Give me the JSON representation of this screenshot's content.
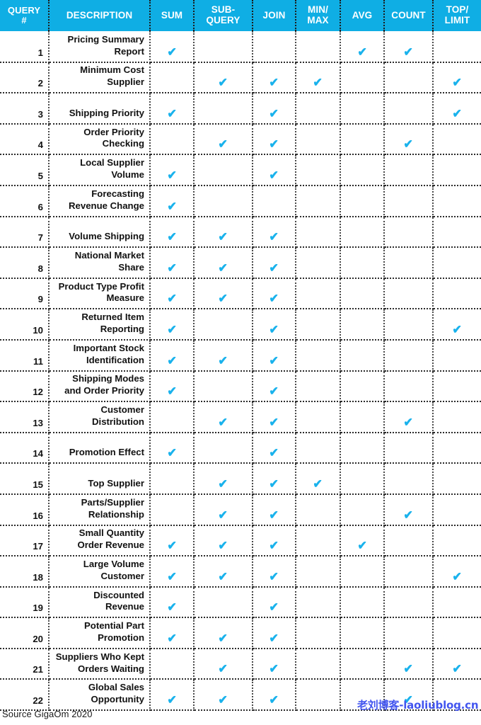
{
  "table": {
    "columns": [
      {
        "key": "query_no",
        "label": "QUERY\n#",
        "label_lines": [
          "QUERY",
          "#"
        ]
      },
      {
        "key": "description",
        "label": "DESCRIPTION",
        "label_lines": [
          "DESCRIPTION"
        ]
      },
      {
        "key": "sum",
        "label": "SUM",
        "label_lines": [
          "SUM"
        ]
      },
      {
        "key": "subquery",
        "label": "SUB-QUERY",
        "label_lines": [
          "SUB-",
          "QUERY"
        ]
      },
      {
        "key": "join",
        "label": "JOIN",
        "label_lines": [
          "JOIN"
        ]
      },
      {
        "key": "minmax",
        "label": "MIN/MAX",
        "label_lines": [
          "MIN/",
          "MAX"
        ]
      },
      {
        "key": "avg",
        "label": "AVG",
        "label_lines": [
          "AVG"
        ]
      },
      {
        "key": "count",
        "label": "COUNT",
        "label_lines": [
          "COUNT"
        ]
      },
      {
        "key": "toplimit",
        "label": "TOP/LIMIT",
        "label_lines": [
          "TOP/",
          "LIMIT"
        ]
      }
    ],
    "check_glyph": "✔",
    "rows": [
      {
        "query_no": "1",
        "description": "Pricing Summary Report",
        "sum": true,
        "subquery": false,
        "join": false,
        "minmax": false,
        "avg": true,
        "count": true,
        "toplimit": false
      },
      {
        "query_no": "2",
        "description": "Minimum Cost Supplier",
        "sum": false,
        "subquery": true,
        "join": true,
        "minmax": true,
        "avg": false,
        "count": false,
        "toplimit": true
      },
      {
        "query_no": "3",
        "description": "Shipping Priority",
        "sum": true,
        "subquery": false,
        "join": true,
        "minmax": false,
        "avg": false,
        "count": false,
        "toplimit": true
      },
      {
        "query_no": "4",
        "description": "Order Priority Checking",
        "sum": false,
        "subquery": true,
        "join": true,
        "minmax": false,
        "avg": false,
        "count": true,
        "toplimit": false
      },
      {
        "query_no": "5",
        "description": "Local Supplier Volume",
        "sum": true,
        "subquery": false,
        "join": true,
        "minmax": false,
        "avg": false,
        "count": false,
        "toplimit": false
      },
      {
        "query_no": "6",
        "description": "Forecasting Revenue Change",
        "sum": true,
        "subquery": false,
        "join": false,
        "minmax": false,
        "avg": false,
        "count": false,
        "toplimit": false
      },
      {
        "query_no": "7",
        "description": "Volume Shipping",
        "sum": true,
        "subquery": true,
        "join": true,
        "minmax": false,
        "avg": false,
        "count": false,
        "toplimit": false
      },
      {
        "query_no": "8",
        "description": "National Market Share",
        "sum": true,
        "subquery": true,
        "join": true,
        "minmax": false,
        "avg": false,
        "count": false,
        "toplimit": false
      },
      {
        "query_no": "9",
        "description": "Product Type Profit Measure",
        "sum": true,
        "subquery": true,
        "join": true,
        "minmax": false,
        "avg": false,
        "count": false,
        "toplimit": false
      },
      {
        "query_no": "10",
        "description": "Returned Item Reporting",
        "sum": true,
        "subquery": false,
        "join": true,
        "minmax": false,
        "avg": false,
        "count": false,
        "toplimit": true
      },
      {
        "query_no": "11",
        "description": "Important Stock Identification",
        "sum": true,
        "subquery": true,
        "join": true,
        "minmax": false,
        "avg": false,
        "count": false,
        "toplimit": false
      },
      {
        "query_no": "12",
        "description": "Shipping Modes and Order Priority",
        "sum": true,
        "subquery": false,
        "join": true,
        "minmax": false,
        "avg": false,
        "count": false,
        "toplimit": false
      },
      {
        "query_no": "13",
        "description": "Customer Distribution",
        "sum": false,
        "subquery": true,
        "join": true,
        "minmax": false,
        "avg": false,
        "count": true,
        "toplimit": false
      },
      {
        "query_no": "14",
        "description": "Promotion Effect",
        "sum": true,
        "subquery": false,
        "join": true,
        "minmax": false,
        "avg": false,
        "count": false,
        "toplimit": false
      },
      {
        "query_no": "15",
        "description": "Top Supplier",
        "sum": false,
        "subquery": true,
        "join": true,
        "minmax": true,
        "avg": false,
        "count": false,
        "toplimit": false
      },
      {
        "query_no": "16",
        "description": "Parts/Supplier Relationship",
        "sum": false,
        "subquery": true,
        "join": true,
        "minmax": false,
        "avg": false,
        "count": true,
        "toplimit": false
      },
      {
        "query_no": "17",
        "description": "Small Quantity Order Revenue",
        "sum": true,
        "subquery": true,
        "join": true,
        "minmax": false,
        "avg": true,
        "count": false,
        "toplimit": false
      },
      {
        "query_no": "18",
        "description": "Large Volume Customer",
        "sum": true,
        "subquery": true,
        "join": true,
        "minmax": false,
        "avg": false,
        "count": false,
        "toplimit": true
      },
      {
        "query_no": "19",
        "description": "Discounted Revenue",
        "sum": true,
        "subquery": false,
        "join": true,
        "minmax": false,
        "avg": false,
        "count": false,
        "toplimit": false
      },
      {
        "query_no": "20",
        "description": "Potential Part Promotion",
        "sum": true,
        "subquery": true,
        "join": true,
        "minmax": false,
        "avg": false,
        "count": false,
        "toplimit": false
      },
      {
        "query_no": "21",
        "description": "Suppliers Who Kept Orders Waiting",
        "sum": false,
        "subquery": true,
        "join": true,
        "minmax": false,
        "avg": false,
        "count": true,
        "toplimit": true
      },
      {
        "query_no": "22",
        "description": "Global Sales Opportunity",
        "sum": true,
        "subquery": true,
        "join": true,
        "minmax": false,
        "avg": false,
        "count": true,
        "toplimit": false
      }
    ]
  },
  "footer": {
    "source": "Source GigaOm 2020"
  },
  "watermark": {
    "text": "老刘博客-laoliublog.cn",
    "color": "#4255ef"
  },
  "colors": {
    "header_blue": "#0FAEE4",
    "check_blue": "#19B2EC",
    "text": "#111111",
    "grid": "#2b2b2b"
  }
}
